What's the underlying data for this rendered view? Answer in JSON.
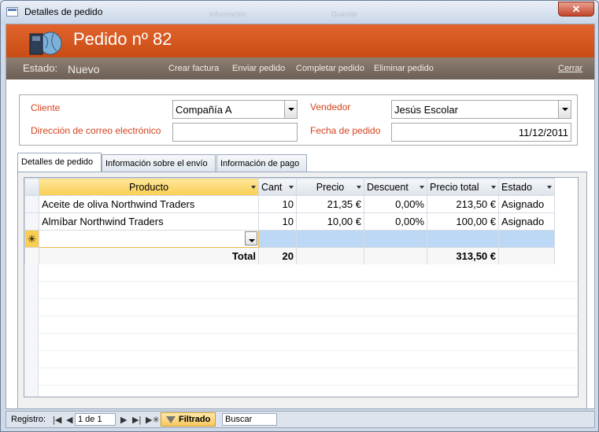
{
  "window": {
    "title": "Detalles de pedido",
    "close_label": "✕"
  },
  "background_ghost": [
    "Información",
    "Guardar"
  ],
  "header": {
    "title": "Pedido nº 82"
  },
  "actions": {
    "estado_label": "Estado:",
    "estado_value": "Nuevo",
    "crear": "Crear factura",
    "enviar": "Enviar pedido",
    "completar": "Completar pedido",
    "eliminar": "Eliminar pedido",
    "cerrar": "Cerrar"
  },
  "fields": {
    "cliente_label": "Cliente",
    "cliente_value": "Compañía A",
    "email_label": "Dirección de correo electrónico",
    "email_value": "",
    "vendedor_label": "Vendedor",
    "vendedor_value": "Jesús Escolar",
    "fecha_label": "Fecha de pedido",
    "fecha_value": "11/12/2011"
  },
  "tabs": [
    "Detalles de pedido",
    "Información sobre el envío",
    "Información de pago"
  ],
  "grid": {
    "columns": [
      "Producto",
      "Cant",
      "Precio",
      "Descuent",
      "Precio total",
      "Estado"
    ],
    "rows": [
      [
        "Aceite de oliva Northwind Traders",
        "10",
        "21,35 €",
        "0,00%",
        "213,50 €",
        "Asignado"
      ],
      [
        "Almíbar Northwind Traders",
        "10",
        "10,00 €",
        "0,00%",
        "100,00 €",
        "Asignado"
      ]
    ],
    "new_row_marker": "✳",
    "total_label": "Total",
    "total_qty": "20",
    "total_amount": "313,50 €"
  },
  "statusbar": {
    "registro": "Registro:",
    "record": "1 de 1",
    "filtrado": "Filtrado",
    "buscar": "Buscar"
  },
  "colors": {
    "header": "#d9581f",
    "label": "#d3431d",
    "bar": "#7d6f64"
  }
}
